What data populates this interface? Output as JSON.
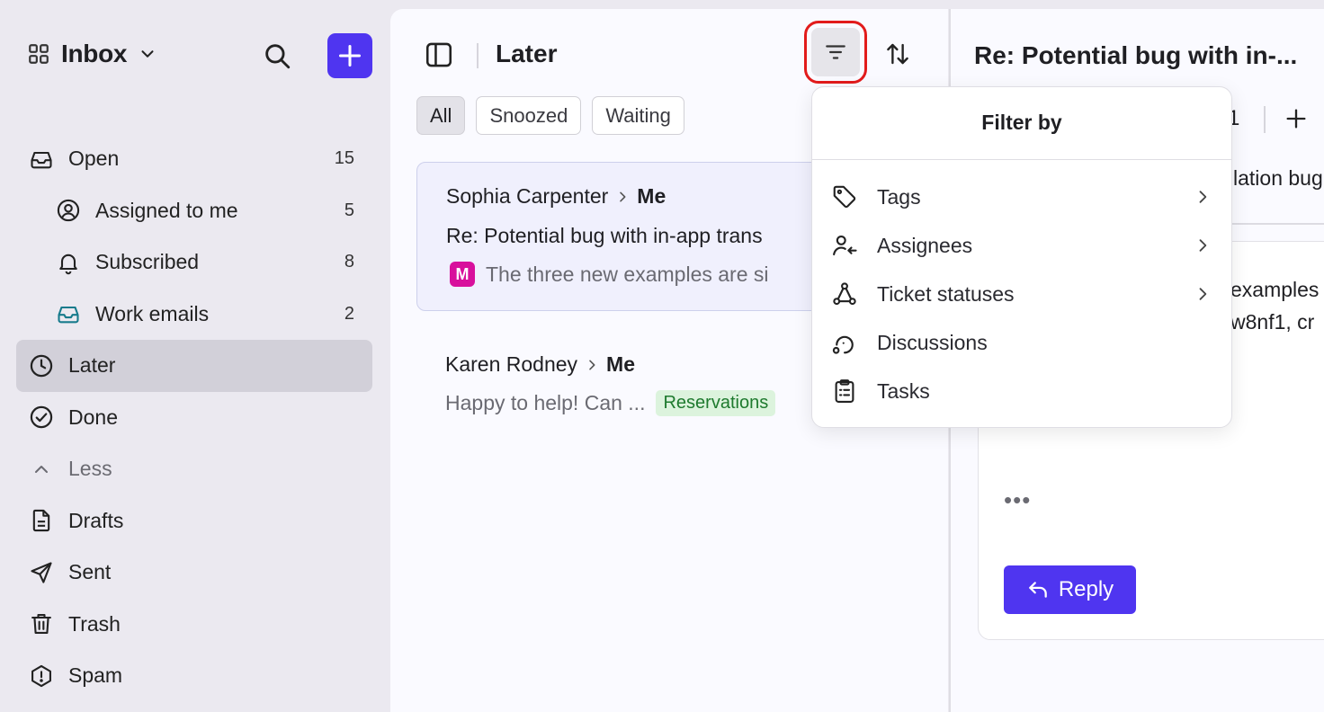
{
  "sidebar": {
    "workspace_title": "Inbox",
    "items": [
      {
        "label": "Open",
        "count": "15",
        "icon": "inbox-icon"
      },
      {
        "label": "Assigned to me",
        "count": "5",
        "icon": "user-circle-icon"
      },
      {
        "label": "Subscribed",
        "count": "8",
        "icon": "bell-icon"
      },
      {
        "label": "Work emails",
        "count": "2",
        "icon": "inbox-teal-icon"
      },
      {
        "label": "Later",
        "count": "",
        "icon": "clock-icon"
      },
      {
        "label": "Done",
        "count": "",
        "icon": "check-circle-icon"
      },
      {
        "label": "Less",
        "count": "",
        "icon": "chevron-up-icon"
      },
      {
        "label": "Drafts",
        "count": "",
        "icon": "file-icon"
      },
      {
        "label": "Sent",
        "count": "",
        "icon": "send-icon"
      },
      {
        "label": "Trash",
        "count": "",
        "icon": "trash-icon"
      },
      {
        "label": "Spam",
        "count": "",
        "icon": "alert-octagon-icon"
      }
    ]
  },
  "list": {
    "title": "Later",
    "chips": [
      "All",
      "Snoozed",
      "Waiting"
    ],
    "conversations": [
      {
        "from": "Sophia Carpenter",
        "to": "Me",
        "subject": "Re: Potential bug with in-app trans",
        "avatar": "M",
        "snippet": "The three new examples are si"
      },
      {
        "from": "Karen Rodney",
        "to": "Me",
        "snippet": "Happy to help! Can ...",
        "tag": "Reservations"
      }
    ]
  },
  "detail": {
    "title": "Re: Potential bug with in-...",
    "count": "1",
    "subtitle_fragment": "lation bug",
    "body_fragment_1": "examples",
    "body_fragment_2": "w8nf1, cr",
    "more": "•••",
    "reply_label": "Reply"
  },
  "filter_menu": {
    "title": "Filter by",
    "items": [
      {
        "label": "Tags",
        "icon": "tag-icon",
        "submenu": true
      },
      {
        "label": "Assignees",
        "icon": "assignee-icon",
        "submenu": true
      },
      {
        "label": "Ticket statuses",
        "icon": "ticket-status-icon",
        "submenu": true
      },
      {
        "label": "Discussions",
        "icon": "discussion-icon",
        "submenu": false
      },
      {
        "label": "Tasks",
        "icon": "clipboard-icon",
        "submenu": false
      }
    ]
  },
  "colors": {
    "accent": "#4f35f0",
    "highlight_outline": "#e21b1b",
    "avatar_bg": "#d8109c",
    "tag_bg": "#dcf3dd",
    "tag_text": "#1e7a2e"
  }
}
